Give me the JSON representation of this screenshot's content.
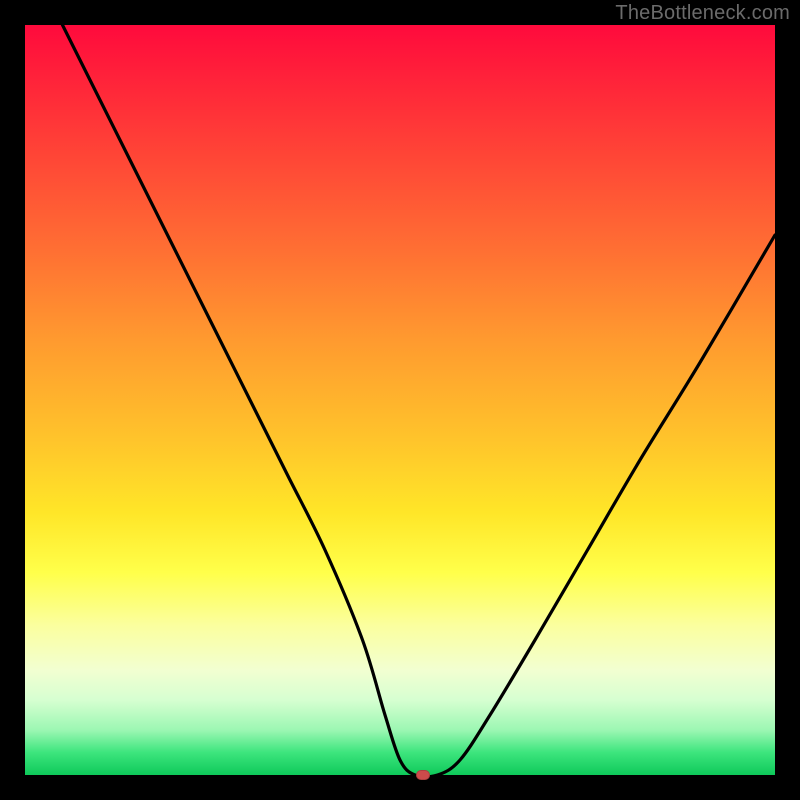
{
  "watermark": {
    "text": "TheBottleneck.com"
  },
  "colors": {
    "curve": "#000000",
    "marker": "#cd4b4b"
  },
  "chart_data": {
    "type": "line",
    "title": "",
    "xlabel": "",
    "ylabel": "",
    "xlim": [
      0,
      100
    ],
    "ylim": [
      0,
      100
    ],
    "grid": false,
    "series": [
      {
        "name": "bottleneck-curve",
        "x": [
          5,
          10,
          15,
          20,
          25,
          30,
          35,
          40,
          45,
          48,
          50,
          52,
          55,
          58,
          62,
          68,
          75,
          82,
          90,
          100
        ],
        "y": [
          100,
          90,
          80,
          70,
          60,
          50,
          40,
          30,
          18,
          8,
          2,
          0,
          0,
          2,
          8,
          18,
          30,
          42,
          55,
          72
        ]
      }
    ],
    "annotations": [
      {
        "name": "minimum-marker",
        "x": 53,
        "y": 0
      }
    ]
  }
}
